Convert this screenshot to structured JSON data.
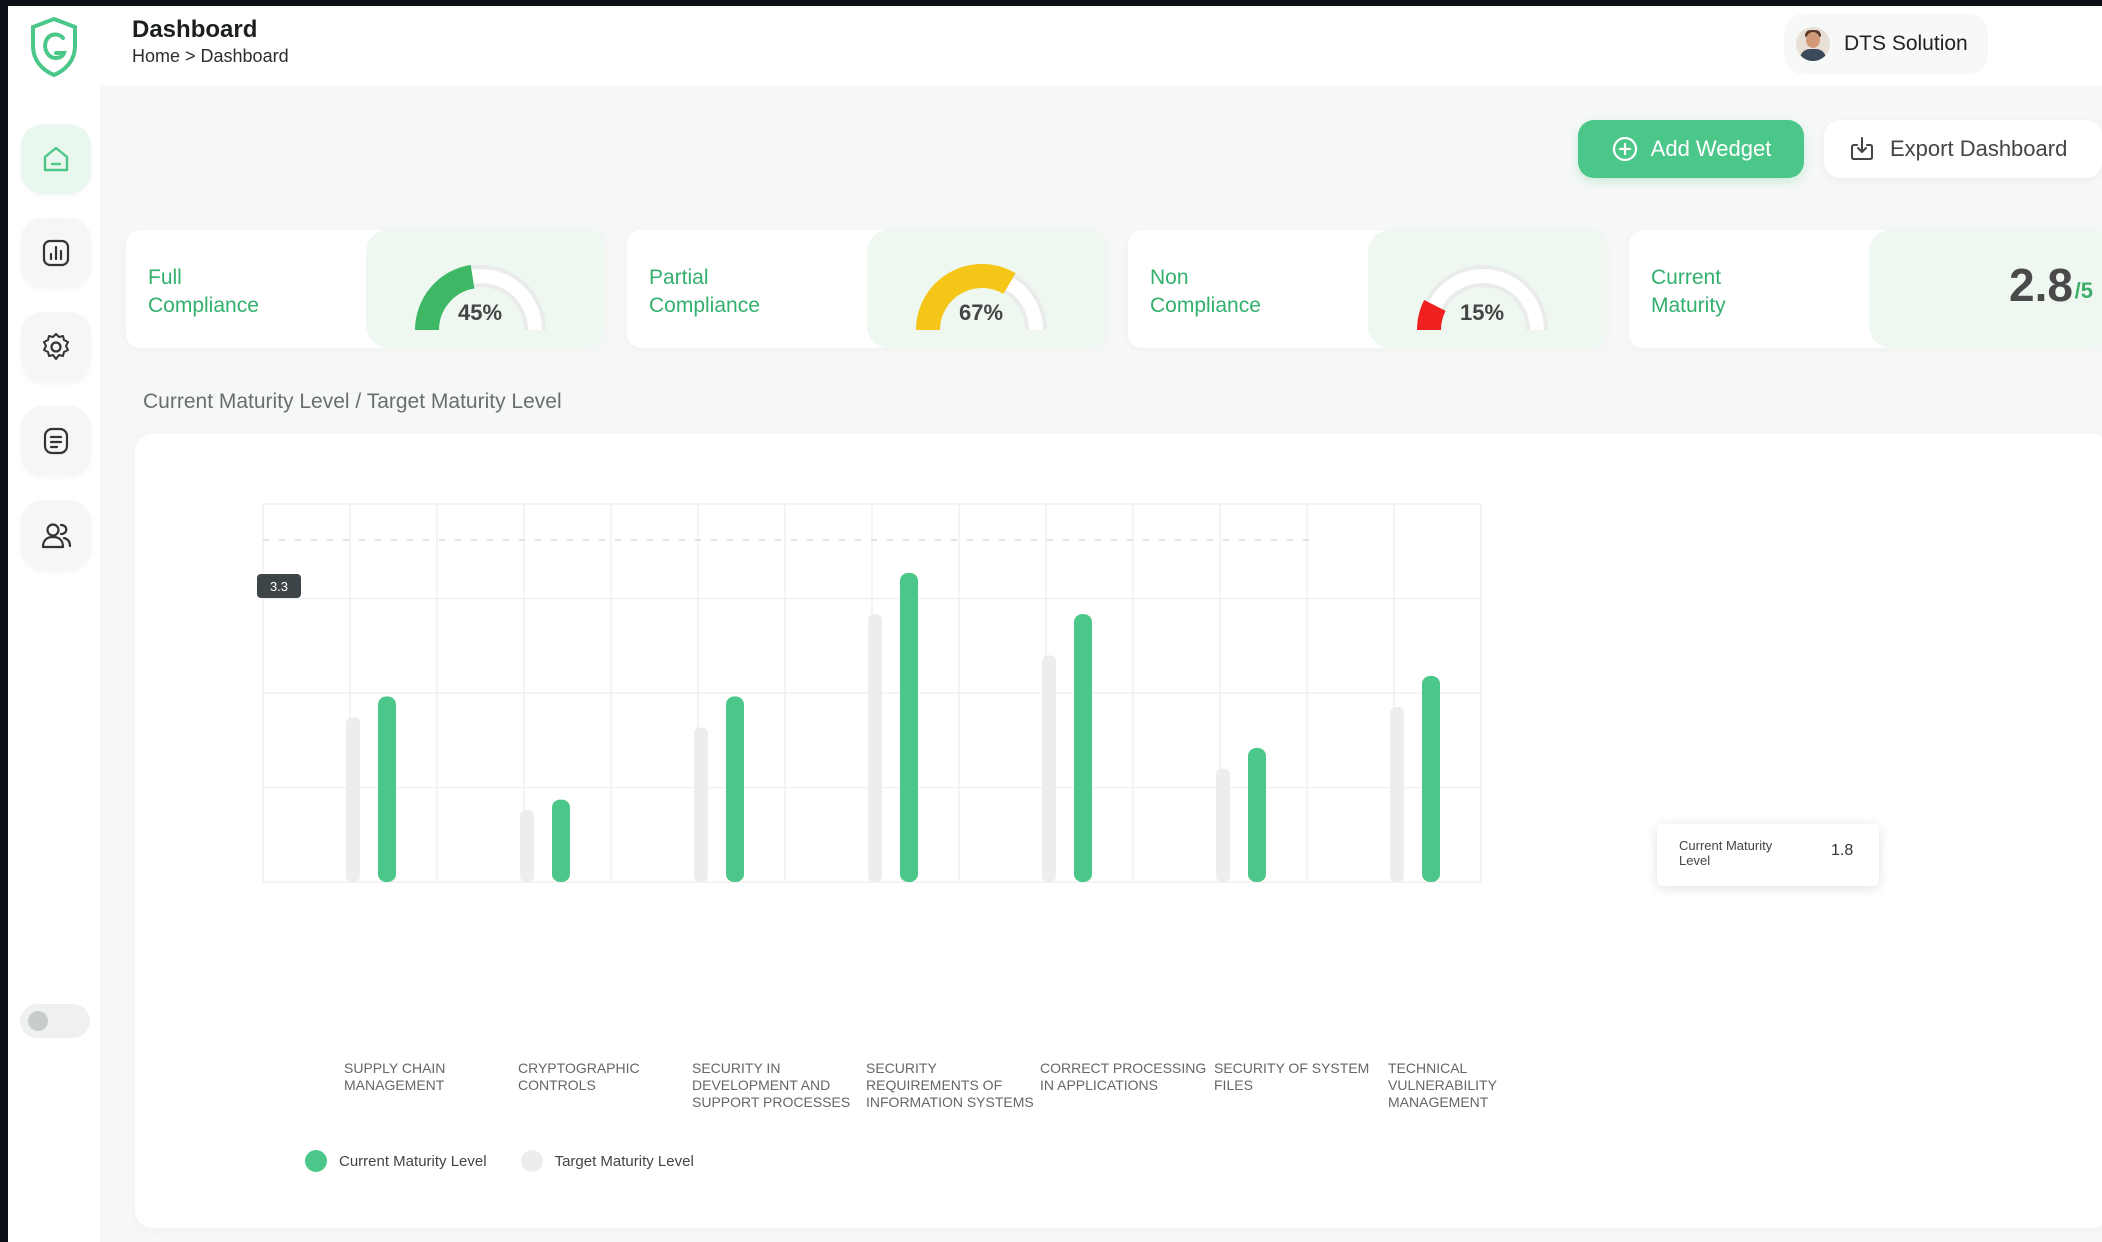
{
  "header": {
    "title": "Dashboard",
    "breadcrumb": "Home > Dashboard",
    "user_name": "DTS Solution"
  },
  "sidebar": {
    "items": [
      {
        "name": "home",
        "icon": "home-icon",
        "active": true
      },
      {
        "name": "reports",
        "icon": "chart-icon",
        "active": false
      },
      {
        "name": "settings",
        "icon": "gear-icon",
        "active": false
      },
      {
        "name": "documents",
        "icon": "document-icon",
        "active": false
      },
      {
        "name": "users",
        "icon": "users-icon",
        "active": false
      }
    ]
  },
  "actions": {
    "add_label": "Add Wedget",
    "export_label": "Export Dashboard"
  },
  "cards": [
    {
      "label": "Full Compliance",
      "value_text": "45%",
      "percent": 45,
      "color": "#3fb866"
    },
    {
      "label": "Partial Compliance",
      "value_text": "67%",
      "percent": 67,
      "color": "#f5c518"
    },
    {
      "label": "Non Compliance",
      "value_text": "15%",
      "percent": 15,
      "color": "#ef2020"
    },
    {
      "label": "Current Maturity",
      "value_text": "2.8",
      "unit": "/5"
    }
  ],
  "chart_section": {
    "title": "Current Maturity Level / Target Maturity Level"
  },
  "colors": {
    "accent": "#4cc78a",
    "current_bar": "#4cc78a",
    "target_bar": "#eceeed"
  },
  "chart_data": {
    "type": "bar",
    "categories": [
      "SUPPLY CHAIN MANAGEMENT",
      "CRYPTOGRAPHIC CONTROLS",
      "SECURITY IN DEVELOPMENT AND SUPPORT PROCESSES",
      "SECURITY REQUIREMENTS OF INFORMATION SYSTEMS",
      "CORRECT PROCESSING IN APPLICATIONS",
      "SECURITY OF SYSTEM FILES",
      "TECHNICAL VULNERABILITY MANAGEMENT"
    ],
    "series": [
      {
        "name": "Current Maturity Level",
        "values": [
          1.8,
          0.8,
          1.8,
          3.0,
          2.6,
          1.3,
          2.0
        ]
      },
      {
        "name": "Target Maturity Level",
        "values": [
          1.6,
          0.7,
          1.5,
          2.6,
          2.2,
          1.1,
          1.7
        ]
      }
    ],
    "ylim": [
      0,
      3.3
    ],
    "marker_value": "3.3",
    "tooltip": {
      "label": "Current Maturity Level",
      "value": "1.8"
    },
    "grid": true,
    "legend": "bottom-left"
  }
}
